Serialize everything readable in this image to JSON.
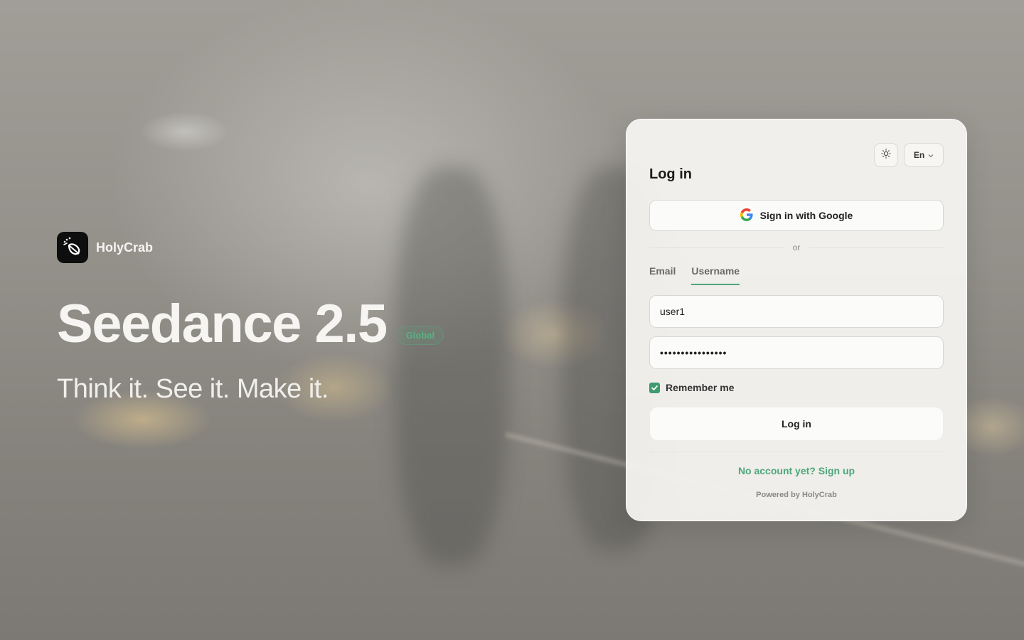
{
  "brand": {
    "name": "HolyCrab",
    "logo_icon": "comet-logo-icon"
  },
  "hero": {
    "title": "Seedance 2.5",
    "badge": "Global",
    "tagline": "Think it. See it. Make it."
  },
  "login_card": {
    "theme_toggle_icon": "sun-icon",
    "language": "En",
    "title": "Log in",
    "google_button": "Sign in with Google",
    "divider_text": "or",
    "tabs": [
      {
        "label": "Email",
        "active": false
      },
      {
        "label": "Username",
        "active": true
      }
    ],
    "username_value": "user1",
    "password_value": "••••••••••••••••",
    "remember_me": {
      "label": "Remember me",
      "checked": true
    },
    "login_button": "Log in",
    "signup_link": "No account yet? Sign up",
    "powered_by": "Powered by HolyCrab"
  },
  "colors": {
    "accent": "#4ea67a",
    "card_bg": "#f5f4f1"
  }
}
